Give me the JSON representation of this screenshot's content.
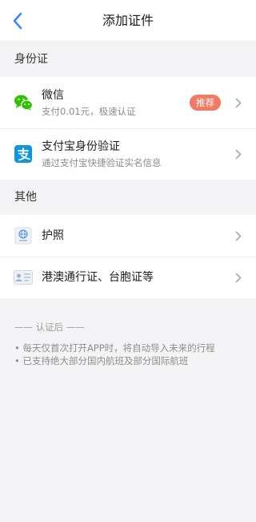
{
  "header": {
    "title": "添加证件",
    "back_icon": "chevron-left-icon"
  },
  "sections": {
    "id_card": {
      "label": "身份证",
      "items": [
        {
          "icon": "wechat-icon",
          "title": "微信",
          "subtitle": "支付0.01元，极速认证",
          "badge": "推荐"
        },
        {
          "icon": "alipay-icon",
          "title": "支付宝身份验证",
          "subtitle": "通过支付宝快捷验证实名信息"
        }
      ]
    },
    "other": {
      "label": "其他",
      "items": [
        {
          "icon": "passport-icon",
          "title": "护照"
        },
        {
          "icon": "id-card-icon",
          "title": "港澳通行证、台胞证等"
        }
      ]
    }
  },
  "notes": {
    "title": "—— 认证后 ——",
    "lines": [
      "• 每天仅首次打开APP时，将自动导入未来的行程",
      "• 已支持绝大部分国内航班及部分国际航班"
    ]
  },
  "colors": {
    "accent_blue": "#3d8af7",
    "badge": "#f07a64",
    "wechat_green": "#2dc100",
    "alipay_blue": "#1296db",
    "background": "#f4f4f6"
  }
}
